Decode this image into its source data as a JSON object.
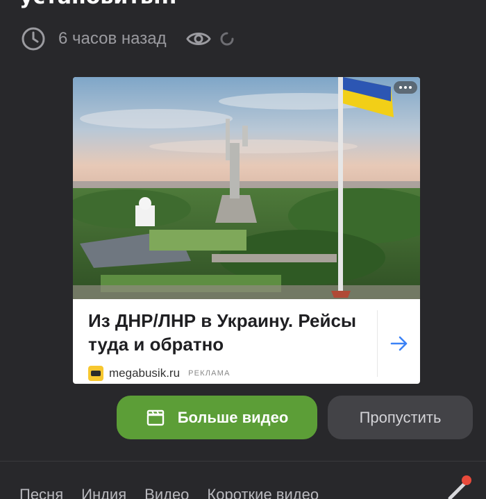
{
  "article": {
    "headline": "установить..."
  },
  "meta": {
    "time_ago": "6 часов назад"
  },
  "ad": {
    "title": "Из ДНР/ЛНР в Украину. Рейсы туда и обратно",
    "domain": "megabusik.ru",
    "label": "РЕКЛАМА"
  },
  "buttons": {
    "more_video": "Больше видео",
    "skip": "Пропустить"
  },
  "tabs": [
    "Песня",
    "Индия",
    "Видео",
    "Короткие видео"
  ],
  "colors": {
    "background": "#28282b",
    "accent_green": "#5c9e37",
    "skip_button": "#434347",
    "arrow_blue": "#3b82f6",
    "notification_dot": "#e84a3b"
  },
  "icons": [
    "clock-icon",
    "eye-icon",
    "loading-spinner-icon",
    "more-dots-icon",
    "arrow-right-icon",
    "clapperboard-icon",
    "edit-pen-icon"
  ]
}
